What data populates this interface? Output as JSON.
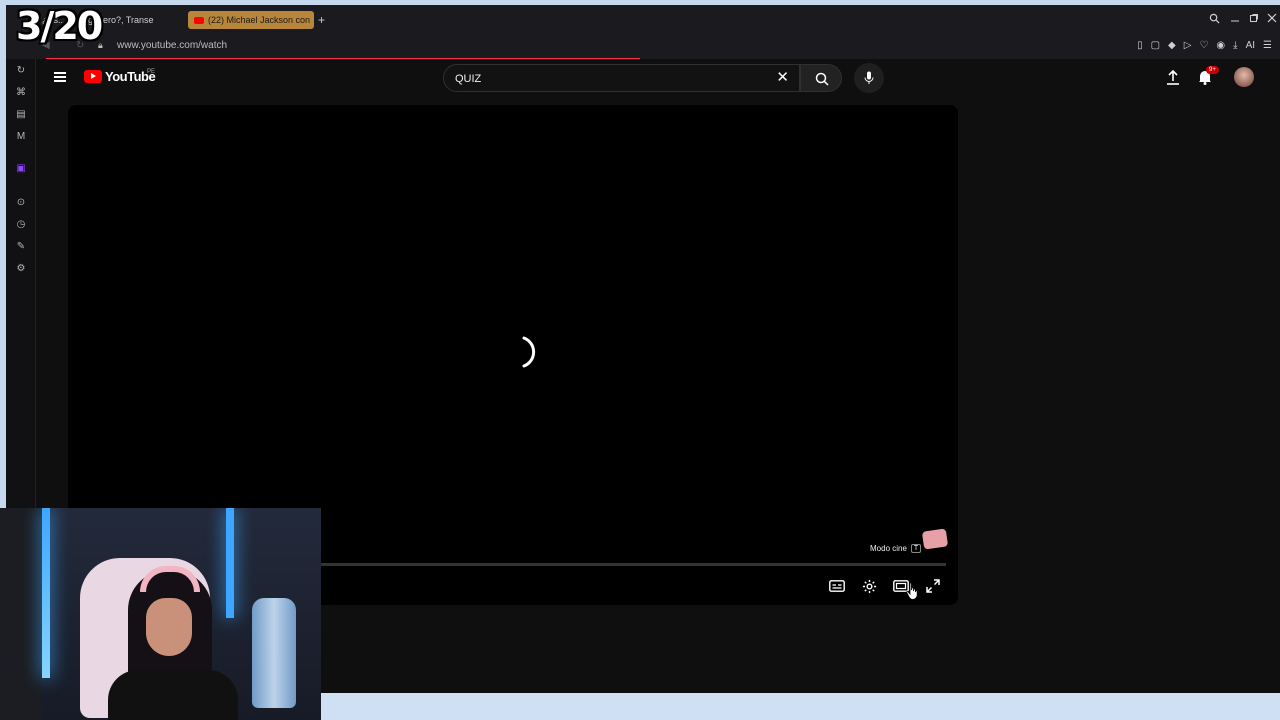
{
  "overlay": {
    "counter": "3/20"
  },
  "browser": {
    "tabs": [
      {
        "label": "¿Es... transgénero?, Transe",
        "active": false
      },
      {
        "label": "(22) Michael Jackson con",
        "active": true
      }
    ],
    "url": "www.youtube.com/watch",
    "new_tab": "+",
    "ai_label": "AI"
  },
  "youtube": {
    "logo_text": "YouTube",
    "country_code": "PE",
    "search_value": "QUIZ",
    "notification_count": "9+",
    "player": {
      "tooltip_label": "Modo cine",
      "tooltip_key": "T"
    }
  },
  "colors": {
    "accent": "#ff0000",
    "load_bar": "#ff2e55",
    "active_tab": "#b8863a"
  }
}
